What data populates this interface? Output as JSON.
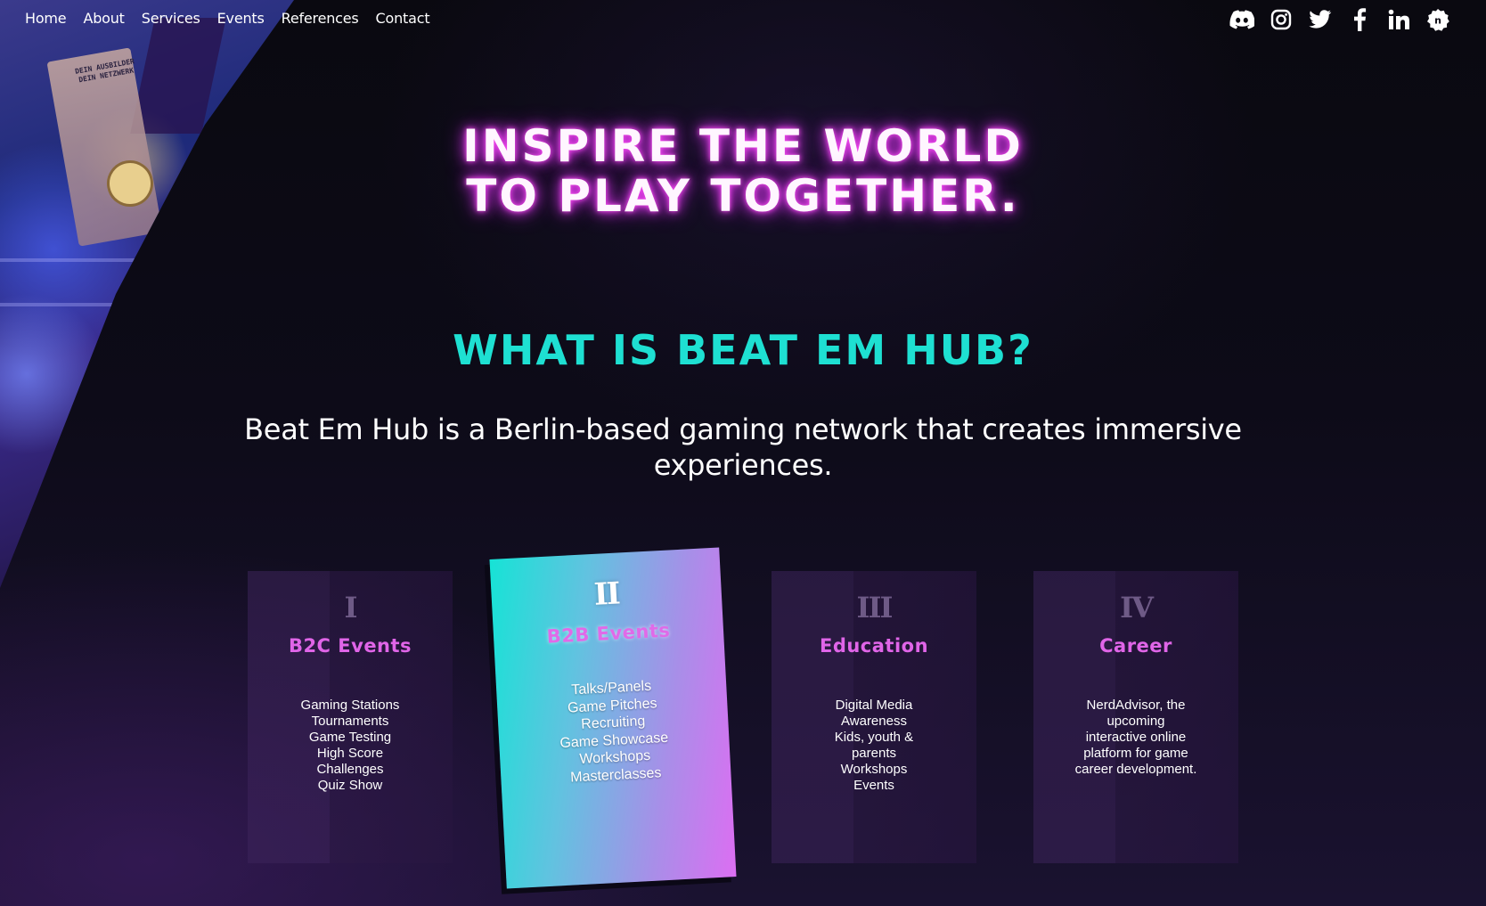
{
  "nav": {
    "items": [
      "Home",
      "About",
      "Services",
      "Events",
      "References",
      "Contact"
    ]
  },
  "social": {
    "icons": [
      "discord-icon",
      "instagram-icon",
      "twitter-icon",
      "facebook-icon",
      "linkedin-icon",
      "nerdadvisor-icon"
    ]
  },
  "photo": {
    "poster_text": "DEIN AUSBILDER DEIN NETZWERK"
  },
  "hero": {
    "line1": "INSPIRE THE WORLD",
    "line2": "TO PLAY TOGETHER."
  },
  "about": {
    "heading": "WHAT IS BEAT EM HUB?",
    "description": "Beat Em Hub is a Berlin-based gaming network that creates immersive experiences."
  },
  "cards": [
    {
      "number": "I",
      "title": "B2C Events",
      "items": [
        "Gaming Stations",
        "Tournaments",
        "Game Testing",
        "High Score",
        "Challenges",
        "Quiz Show"
      ]
    },
    {
      "number": "II",
      "title": "B2B Events",
      "items": [
        "Talks/Panels",
        "Game Pitches",
        "Recruiting",
        "Game Showcase",
        "Workshops",
        "Masterclasses"
      ]
    },
    {
      "number": "III",
      "title": "Education",
      "items": [
        "Digital Media",
        "Awareness",
        "Kids, youth &",
        "parents",
        "Workshops",
        "Events"
      ]
    },
    {
      "number": "IV",
      "title": "Career",
      "items": [
        "NerdAdvisor, the",
        "upcoming",
        "interactive online",
        "platform for game",
        "career development."
      ]
    }
  ],
  "colors": {
    "accent_teal": "#1ee0d2",
    "accent_pink": "#e065e8",
    "hero_glow": "#e23cf0",
    "background": "#0c0a14"
  }
}
